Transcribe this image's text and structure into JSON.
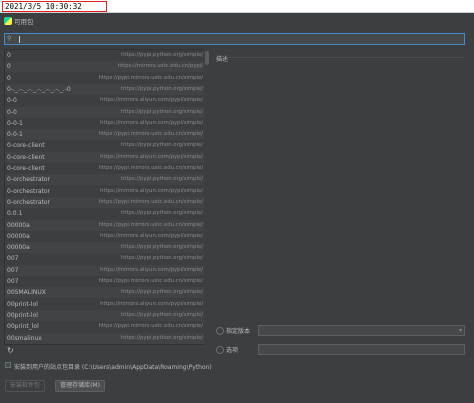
{
  "overlay": {
    "timestamp": "2021/3/5 10:30:32"
  },
  "window": {
    "title": "可用包",
    "accent": "#4a88c7"
  },
  "search": {
    "value": ""
  },
  "packages": [
    {
      "name": "0",
      "repo": "https://pypi.python.org/simple/"
    },
    {
      "name": "0",
      "repo": "https://mirrors.ustc.edu.cn/pypi/"
    },
    {
      "name": "0",
      "repo": "https://pypi.mirrors.ustc.edu.cn/simple/"
    },
    {
      "name": "0-._.-._.-._.-._.-._.-._.-0",
      "repo": "https://pypi.python.org/simple/"
    },
    {
      "name": "0-0",
      "repo": "https://mirrors.aliyun.com/pypi/simple/"
    },
    {
      "name": "0-0",
      "repo": "https://pypi.python.org/simple/"
    },
    {
      "name": "0-0-1",
      "repo": "https://mirrors.aliyun.com/pypi/simple/"
    },
    {
      "name": "0-0-1",
      "repo": "https://pypi.mirrors.ustc.edu.cn/simple/"
    },
    {
      "name": "0-core-client",
      "repo": "https://pypi.python.org/simple/"
    },
    {
      "name": "0-core-client",
      "repo": "https://mirrors.aliyun.com/pypi/simple/"
    },
    {
      "name": "0-core-client",
      "repo": "https://pypi.mirrors.ustc.edu.cn/simple/"
    },
    {
      "name": "0-orchestrator",
      "repo": "https://pypi.python.org/simple/"
    },
    {
      "name": "0-orchestrator",
      "repo": "https://mirrors.aliyun.com/pypi/simple/"
    },
    {
      "name": "0-orchestrator",
      "repo": "https://pypi.mirrors.ustc.edu.cn/simple/"
    },
    {
      "name": "0.0.1",
      "repo": "https://pypi.python.org/simple/"
    },
    {
      "name": "00000a",
      "repo": "https://pypi.mirrors.ustc.edu.cn/simple/"
    },
    {
      "name": "00000a",
      "repo": "https://mirrors.aliyun.com/pypi/simple/"
    },
    {
      "name": "00000a",
      "repo": "https://pypi.python.org/simple/"
    },
    {
      "name": "007",
      "repo": "https://pypi.python.org/simple/"
    },
    {
      "name": "007",
      "repo": "https://mirrors.aliyun.com/pypi/simple/"
    },
    {
      "name": "007",
      "repo": "https://pypi.mirrors.ustc.edu.cn/simple/"
    },
    {
      "name": "00SMALINUX",
      "repo": "https://pypi.python.org/simple/"
    },
    {
      "name": "00print-lol",
      "repo": "https://mirrors.aliyun.com/pypi/simple/"
    },
    {
      "name": "00print-lol",
      "repo": "https://pypi.python.org/simple/"
    },
    {
      "name": "00print_lol",
      "repo": "https://pypi.mirrors.ustc.edu.cn/simple/"
    },
    {
      "name": "00smalinux",
      "repo": "https://pypi.python.org/simple/"
    }
  ],
  "details": {
    "description_label": "描述"
  },
  "options": {
    "version_label": "指定版本",
    "version_value": "",
    "options_label": "选项",
    "options_value": "",
    "user_site_label": "安装到用户的站点包目录 (C:\\Users\\admin\\AppData\\Roaming\\Python)"
  },
  "buttons": {
    "install_label": "安装软件包",
    "manage_repos_label": "管理存储库(M)"
  },
  "icons": {
    "search": "search-icon",
    "refresh": "refresh-icon",
    "app": "pycharm-icon",
    "dropdown": "chevron-down-icon"
  }
}
